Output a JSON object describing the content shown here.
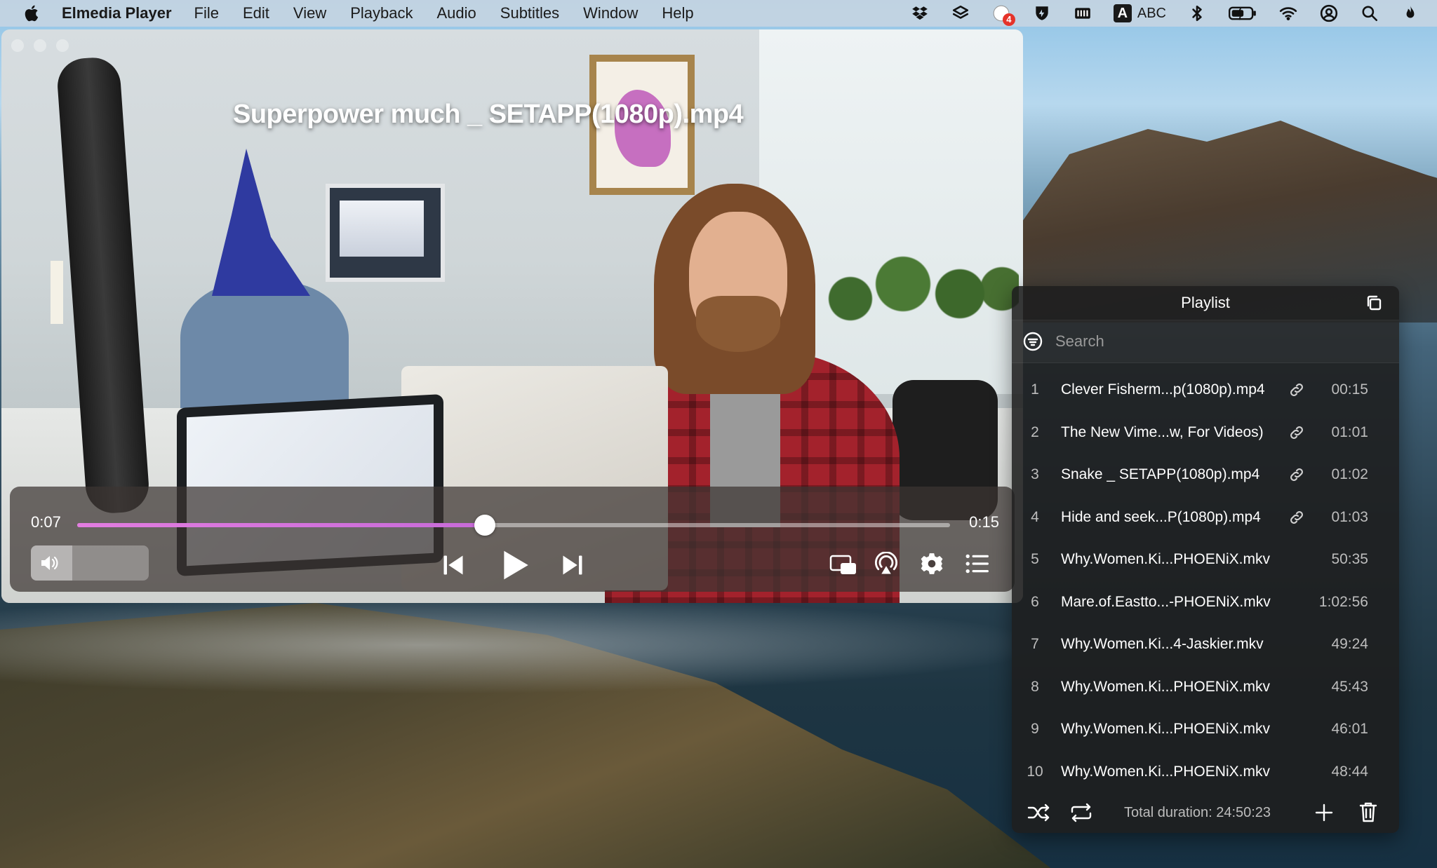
{
  "menubar": {
    "app_name": "Elmedia Player",
    "menus": [
      "File",
      "Edit",
      "View",
      "Playback",
      "Audio",
      "Subtitles",
      "Window",
      "Help"
    ],
    "notification_badge": "4",
    "input_source_label": "ABC",
    "input_source_letter": "A"
  },
  "player": {
    "video_title": "Superpower much _ SETAPP(1080p).mp4",
    "current_time": "0:07",
    "total_time": "0:15",
    "progress_fraction": 0.467,
    "volume_fraction": 0.35,
    "accent_color": "#d874de"
  },
  "playlist": {
    "title": "Playlist",
    "search_placeholder": "Search",
    "items": [
      {
        "num": "1",
        "name": "Clever Fisherm...p(1080p).mp4",
        "duration": "00:15",
        "linked": true
      },
      {
        "num": "2",
        "name": "The New Vime...w, For Videos)",
        "duration": "01:01",
        "linked": true
      },
      {
        "num": "3",
        "name": "Snake _ SETAPP(1080p).mp4",
        "duration": "01:02",
        "linked": true
      },
      {
        "num": "4",
        "name": "Hide and seek...P(1080p).mp4",
        "duration": "01:03",
        "linked": true
      },
      {
        "num": "5",
        "name": "Why.Women.Ki...PHOENiX.mkv",
        "duration": "50:35",
        "linked": false
      },
      {
        "num": "6",
        "name": "Mare.of.Eastto...-PHOENiX.mkv",
        "duration": "1:02:56",
        "linked": false
      },
      {
        "num": "7",
        "name": "Why.Women.Ki...4-Jaskier.mkv",
        "duration": "49:24",
        "linked": false
      },
      {
        "num": "8",
        "name": "Why.Women.Ki...PHOENiX.mkv",
        "duration": "45:43",
        "linked": false
      },
      {
        "num": "9",
        "name": "Why.Women.Ki...PHOENiX.mkv",
        "duration": "46:01",
        "linked": false
      },
      {
        "num": "10",
        "name": "Why.Women.Ki...PHOENiX.mkv",
        "duration": "48:44",
        "linked": false
      }
    ],
    "total_duration": "Total duration: 24:50:23"
  }
}
